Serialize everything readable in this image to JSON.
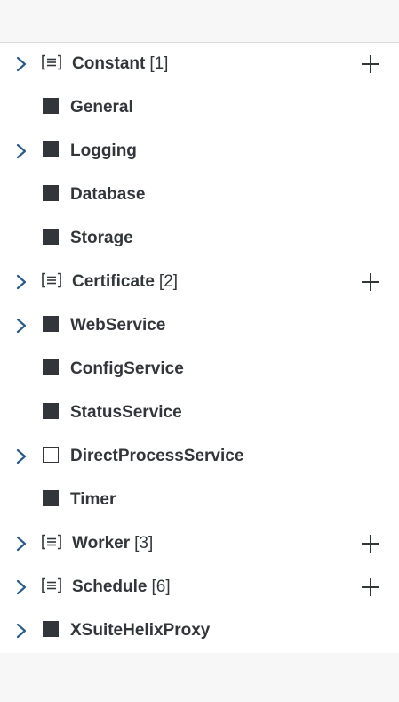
{
  "tree": {
    "items": [
      {
        "label": "Constant",
        "count": "[1]",
        "kind": "group",
        "expandable": true,
        "add": true
      },
      {
        "label": "General",
        "count": "",
        "kind": "filled",
        "expandable": false,
        "add": false
      },
      {
        "label": "Logging",
        "count": "",
        "kind": "filled",
        "expandable": true,
        "add": false
      },
      {
        "label": "Database",
        "count": "",
        "kind": "filled",
        "expandable": false,
        "add": false
      },
      {
        "label": "Storage",
        "count": "",
        "kind": "filled",
        "expandable": false,
        "add": false
      },
      {
        "label": "Certificate",
        "count": "[2]",
        "kind": "group",
        "expandable": true,
        "add": true
      },
      {
        "label": "WebService",
        "count": "",
        "kind": "filled",
        "expandable": true,
        "add": false
      },
      {
        "label": "ConfigService",
        "count": "",
        "kind": "filled",
        "expandable": false,
        "add": false
      },
      {
        "label": "StatusService",
        "count": "",
        "kind": "filled",
        "expandable": false,
        "add": false
      },
      {
        "label": "DirectProcessService",
        "count": "",
        "kind": "outline",
        "expandable": true,
        "add": false
      },
      {
        "label": "Timer",
        "count": "",
        "kind": "filled",
        "expandable": false,
        "add": false
      },
      {
        "label": "Worker",
        "count": "[3]",
        "kind": "group",
        "expandable": true,
        "add": true
      },
      {
        "label": "Schedule",
        "count": "[6]",
        "kind": "group",
        "expandable": true,
        "add": true
      },
      {
        "label": "XSuiteHelixProxy",
        "count": "",
        "kind": "filled",
        "expandable": true,
        "add": false
      }
    ]
  },
  "icons": {
    "expand": "chevron-right-icon",
    "group": "list-icon",
    "filled": "filled-square-icon",
    "outline": "empty-square-icon",
    "add": "plus-icon"
  },
  "colors": {
    "chevron": "#2c5a87",
    "text": "#32363a",
    "background": "#ffffff",
    "chrome": "#f7f7f7"
  }
}
